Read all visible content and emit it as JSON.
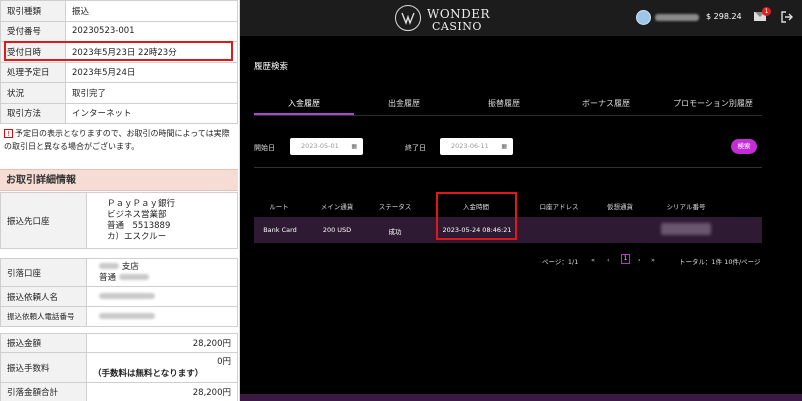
{
  "left": {
    "summary_rows": [
      {
        "key": "取引種類",
        "value": "振込"
      },
      {
        "key": "受付番号",
        "value": "20230523-001"
      },
      {
        "key": "受付日時",
        "value": "2023年5月23日 22時23分"
      },
      {
        "key": "処理予定日",
        "value": "2023年5月24日"
      },
      {
        "key": "状況",
        "value": "取引完了"
      },
      {
        "key": "取引方法",
        "value": "インターネット"
      }
    ],
    "notice": "予定日の表示となりますので、お取引の時間によっては実際の取引日と異なる場合がございます。",
    "notice_mark": "!",
    "detail_header": "お取引詳細情報",
    "dest_key": "振込先口座",
    "dest_lines": [
      "ＰａｙＰａｙ銀行",
      "ビジネス営業部",
      "普通　5513889",
      "カ）エスクルー"
    ],
    "debit_key": "引落口座",
    "debit_branch": "支店",
    "debit_type": "普通",
    "requester_key": "振込依頼人名",
    "requester_phone_key": "振込依頼人電話番号",
    "amount_key": "振込金額",
    "amount_value": "28,200円",
    "fee_key": "振込手数料",
    "fee_value": "0円",
    "fee_note": "（手数料は無料となります）",
    "total_key": "引落金額合計",
    "total_value": "28,200円"
  },
  "casino": {
    "logo_line1": "WONDER",
    "logo_line2": "CASINO",
    "balance": "$ 298.24",
    "mail_count": "1",
    "page_title": "履歴検索",
    "tabs": [
      "入金履歴",
      "出金履歴",
      "振替履歴",
      "ボーナス履歴",
      "プロモーション別履歴"
    ],
    "start_label": "開始日",
    "start_value": "2023-05-01",
    "end_label": "終了日",
    "end_value": "2023-06-11",
    "calendar_glyph": "▦",
    "search_label": "検索",
    "columns": [
      "ルート",
      "メイン通貨",
      "ステータス",
      "入金時間",
      "口座アドレス",
      "仮想通貨",
      "シリアル番号"
    ],
    "row": {
      "route": "Bank Card",
      "amount": "200 USD",
      "status": "成功",
      "time": "2023-05-24 08:46:21",
      "address": "",
      "crypto": ""
    },
    "page_info": "ページ：1/1",
    "pager_first": "«",
    "pager_prev": "‹",
    "current_page": "1",
    "pager_next": "›",
    "pager_last": "»",
    "total": "トータル：1件 10件/ページ"
  },
  "colors": {
    "accent": "#c42dd6",
    "highlight_box": "#e01818"
  }
}
